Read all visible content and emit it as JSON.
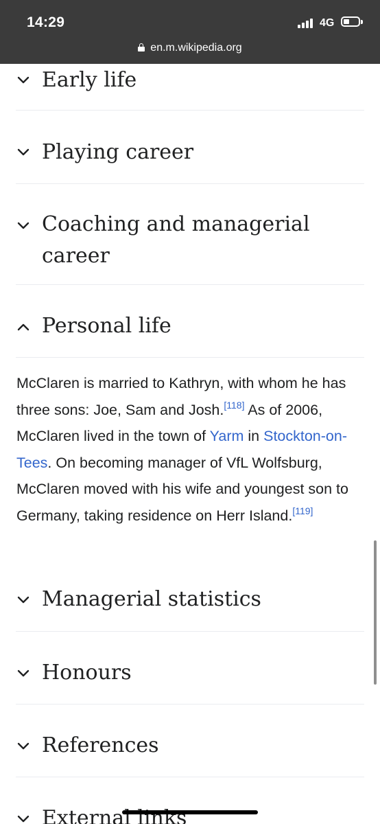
{
  "status_bar": {
    "time": "14:29",
    "network": "4G",
    "url": "en.m.wikipedia.org",
    "icons": [
      "cellular-signal-icon",
      "battery-icon",
      "lock-icon"
    ]
  },
  "sections": [
    {
      "heading": "Early life",
      "expanded": false,
      "icon": "chevron-down-icon"
    },
    {
      "heading": "Playing career",
      "expanded": false,
      "icon": "chevron-down-icon"
    },
    {
      "heading": "Coaching and managerial career",
      "expanded": false,
      "icon": "chevron-down-icon"
    },
    {
      "heading": "Personal life",
      "expanded": true,
      "icon": "chevron-up-icon"
    },
    {
      "heading": "Managerial statistics",
      "expanded": false,
      "icon": "chevron-down-icon"
    },
    {
      "heading": "Honours",
      "expanded": false,
      "icon": "chevron-down-icon"
    },
    {
      "heading": "References",
      "expanded": false,
      "icon": "chevron-down-icon"
    },
    {
      "heading": "External links",
      "expanded": false,
      "icon": "chevron-down-icon"
    }
  ],
  "personal_life": {
    "text_1": "McClaren is married to Kathryn, with whom he has three sons: Joe, Sam and Josh.",
    "ref_1": "[118]",
    "text_2": " As of 2006, McClaren lived in the town of ",
    "link_yarm": "Yarm",
    "text_3": " in ",
    "link_stockton": "Stockton-on-Tees",
    "text_4": ". On becoming manager of VfL Wolfsburg, McClaren moved with his wife and youngest son to Germany, taking residence on Herr Island.",
    "ref_2": "[119]"
  },
  "colors": {
    "link": "#3366cc",
    "text": "#202122",
    "divider": "#eaecf0",
    "top_bar": "#3b3b3b"
  }
}
